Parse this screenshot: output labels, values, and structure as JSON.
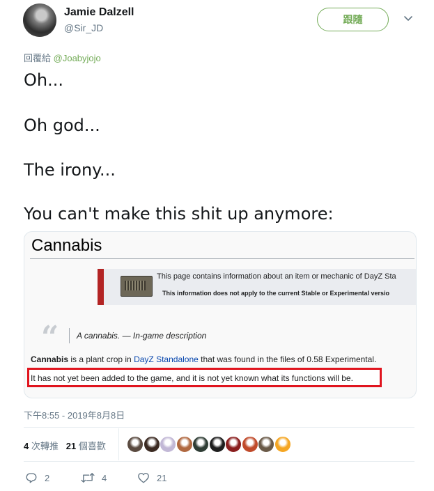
{
  "author": {
    "name": "Jamie Dalzell",
    "handle": "@Sir_JD"
  },
  "follow_label": "跟隨",
  "reply_to": {
    "prefix": "回覆給",
    "mention": "@Joabyjojo"
  },
  "tweet_lines": [
    "Oh...",
    "Oh god...",
    "The irony...",
    "You can't make this shit up anymore:"
  ],
  "card": {
    "title": "Cannabis",
    "notice_line1": "This page contains information about an item or mechanic of DayZ Sta",
    "notice_line2": "This information does not apply to the current Stable or Experimental versio",
    "quote_text": "A cannabis. — In-game description",
    "para1_bold": "Cannabis",
    "para1_before_link": " is a plant crop in ",
    "para1_link": "DayZ Standalone",
    "para1_after_link": " that was found in the files of 0.58 Experimental.",
    "para2": "It has not yet been added to the game, and it is not yet known what its functions will be."
  },
  "timestamp": "下午8:55 - 2019年8月8日",
  "stats": {
    "retweets_count": "4",
    "retweets_label": "次轉推",
    "likes_count": "21",
    "likes_label": "個喜歡"
  },
  "likers": [
    {
      "color": "#5a4a40"
    },
    {
      "color": "#3b2a22"
    },
    {
      "color": "#c2b8d6"
    },
    {
      "color": "#b06840"
    },
    {
      "color": "#2f3d35"
    },
    {
      "color": "#1e1e1e"
    },
    {
      "color": "#8a1e1e"
    },
    {
      "color": "#c04a2a"
    },
    {
      "color": "#6a5a48"
    },
    {
      "color": "#f5a623"
    }
  ],
  "actions": {
    "replies": "2",
    "retweets": "4",
    "likes": "21"
  },
  "colors": {
    "accent_green": "#73ab57",
    "highlight_red": "#e0141e",
    "secondary_text": "#657786"
  }
}
